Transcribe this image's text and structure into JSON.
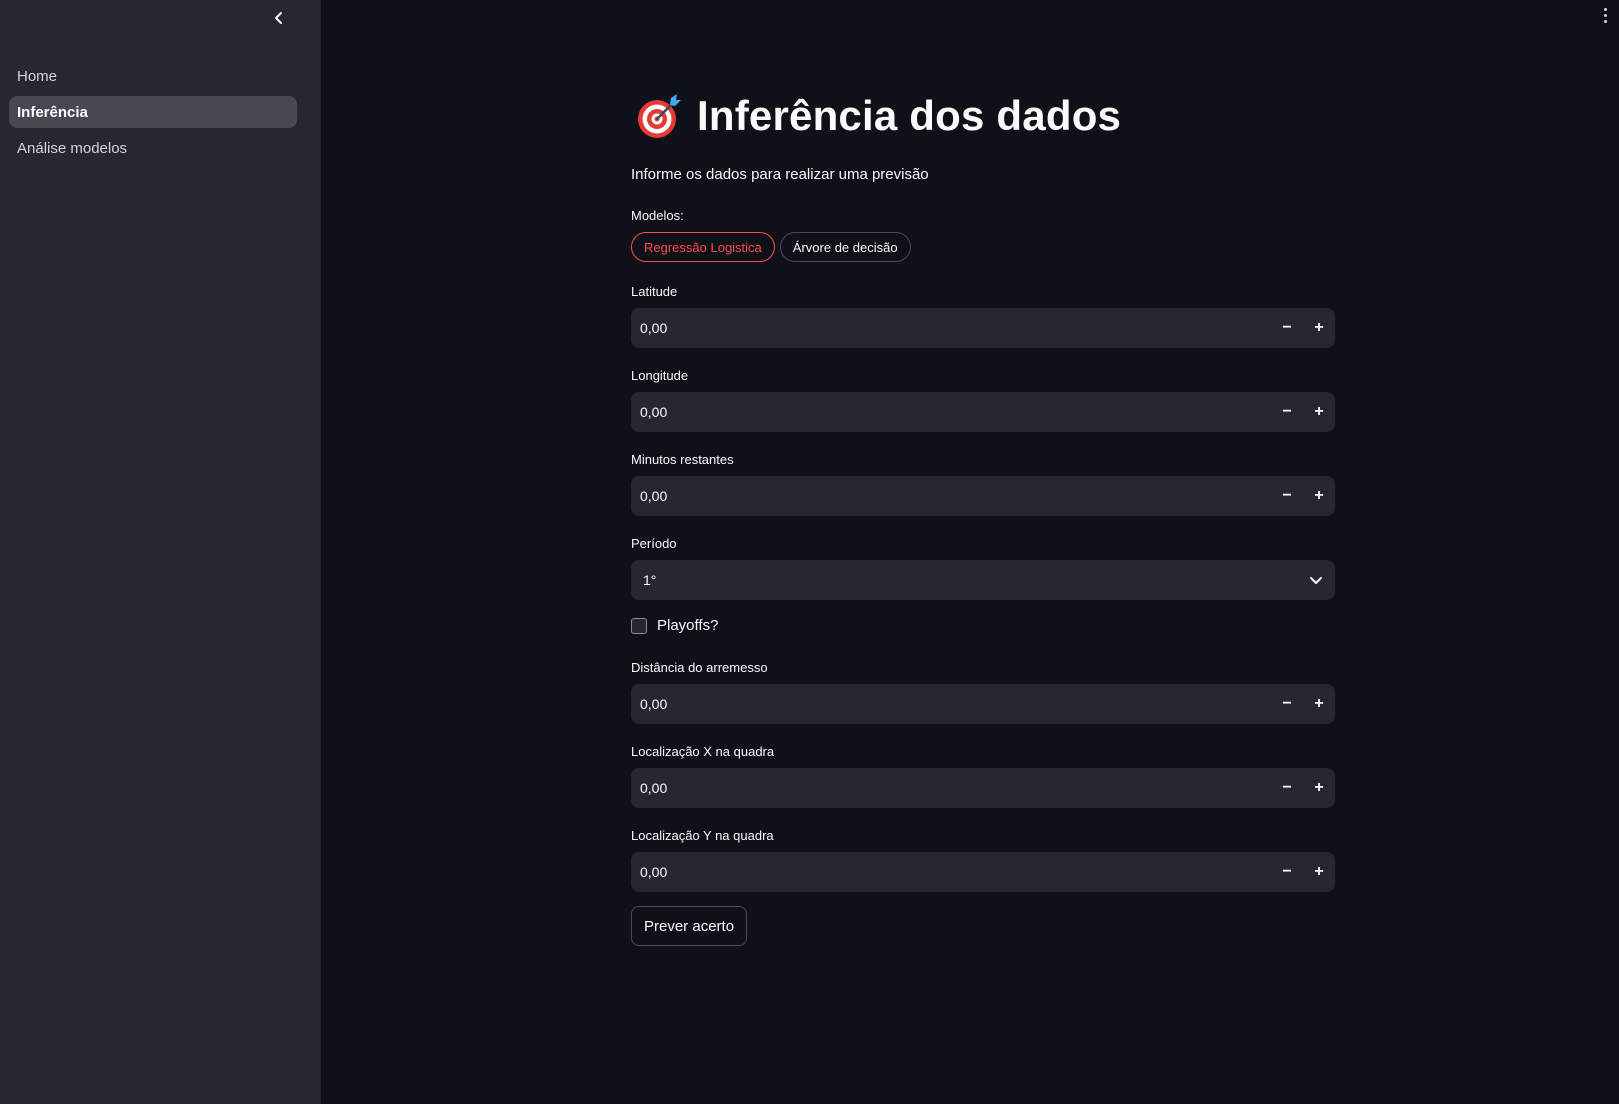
{
  "sidebar": {
    "items": [
      {
        "label": "Home"
      },
      {
        "label": "Inferência"
      },
      {
        "label": "Análise modelos"
      }
    ],
    "active_index": 1
  },
  "page": {
    "title": "Inferência dos dados",
    "title_icon": "target-dart-icon",
    "subtitle": "Informe os dados para realizar uma previsão"
  },
  "models": {
    "label": "Modelos:",
    "options": [
      "Regressão Logistica",
      "Árvore de decisão"
    ],
    "selected": "Regressão Logistica"
  },
  "fields": {
    "latitude": {
      "label": "Latitude",
      "value": "0,00"
    },
    "longitude": {
      "label": "Longitude",
      "value": "0,00"
    },
    "minutos": {
      "label": "Minutos restantes",
      "value": "0,00"
    },
    "periodo": {
      "label": "Período",
      "value": "1°"
    },
    "playoffs": {
      "label": "Playoffs?",
      "checked": false
    },
    "distancia": {
      "label": "Distância do arremesso",
      "value": "0,00"
    },
    "loc_x": {
      "label": "Localização X na quadra",
      "value": "0,00"
    },
    "loc_y": {
      "label": "Localização Y na quadra",
      "value": "0,00"
    }
  },
  "stepper": {
    "minus": "−",
    "plus": "+"
  },
  "actions": {
    "predict_label": "Prever acerto"
  },
  "colors": {
    "background": "#0e1117",
    "sidebar": "#262730",
    "accent": "#ff4b4b",
    "input": "#262730"
  }
}
